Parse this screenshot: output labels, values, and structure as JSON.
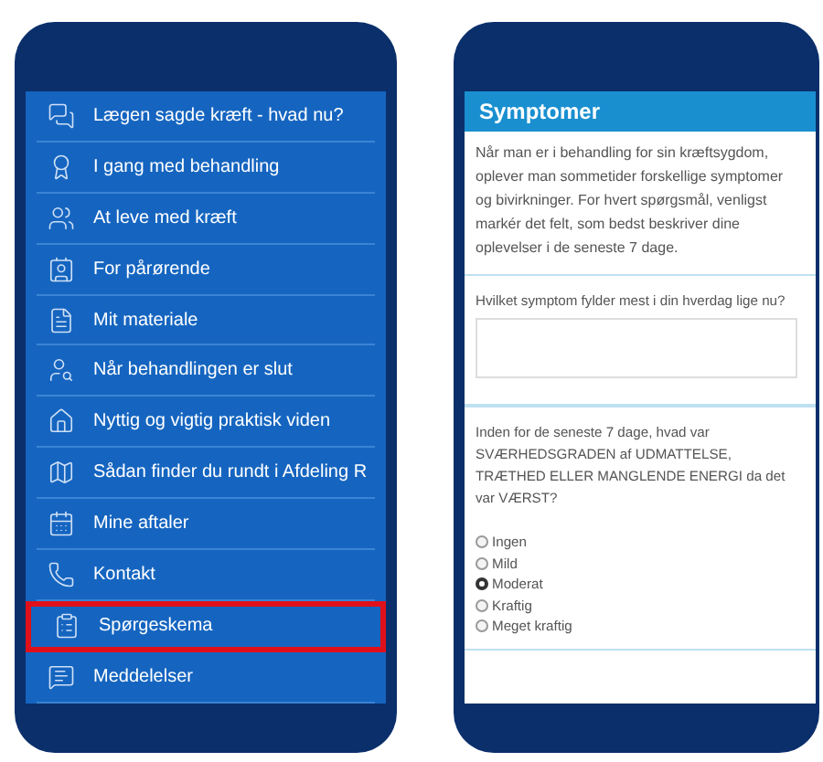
{
  "menu": {
    "items": [
      {
        "label": "Lægen sagde kræft - hvad nu?",
        "selected": false
      },
      {
        "label": "I gang med behandling",
        "selected": false
      },
      {
        "label": "At leve med kræft",
        "selected": false
      },
      {
        "label": "For pårørende",
        "selected": false
      },
      {
        "label": "Mit materiale",
        "selected": false
      },
      {
        "label": "Når behandlingen er slut",
        "selected": false
      },
      {
        "label": "Nyttig og vigtig praktisk viden",
        "selected": false
      },
      {
        "label": "Sådan finder du rundt i Afdeling R",
        "selected": false
      },
      {
        "label": "Mine aftaler",
        "selected": false
      },
      {
        "label": "Kontakt",
        "selected": false
      },
      {
        "label": "Spørgeskema",
        "selected": true
      },
      {
        "label": "Meddelelser",
        "selected": false
      }
    ]
  },
  "form": {
    "title": "Symptomer",
    "intro": "Når man er i behandling for sin kræftsygdom, oplever man sommetider forskellige symptomer og bivirkninger. For hvert spørgsmål, venligst markér det felt, som bedst beskriver dine oplevelser i de seneste 7 dage.",
    "question_1": "Hvilket symptom fylder mest i din hverdag lige nu?",
    "question_2": "Inden for de seneste 7 dage, hvad var SVÆRHEDSGRADEN af UDMATTELSE, TRÆTHED ELLER MANGLENDE ENERGI da det var VÆRST?",
    "options": [
      {
        "label": "Ingen",
        "selected": false
      },
      {
        "label": "Mild",
        "selected": false
      },
      {
        "label": "Moderat",
        "selected": true
      },
      {
        "label": "Kraftig",
        "selected": false
      },
      {
        "label": "Meget kraftig",
        "selected": false
      }
    ]
  }
}
